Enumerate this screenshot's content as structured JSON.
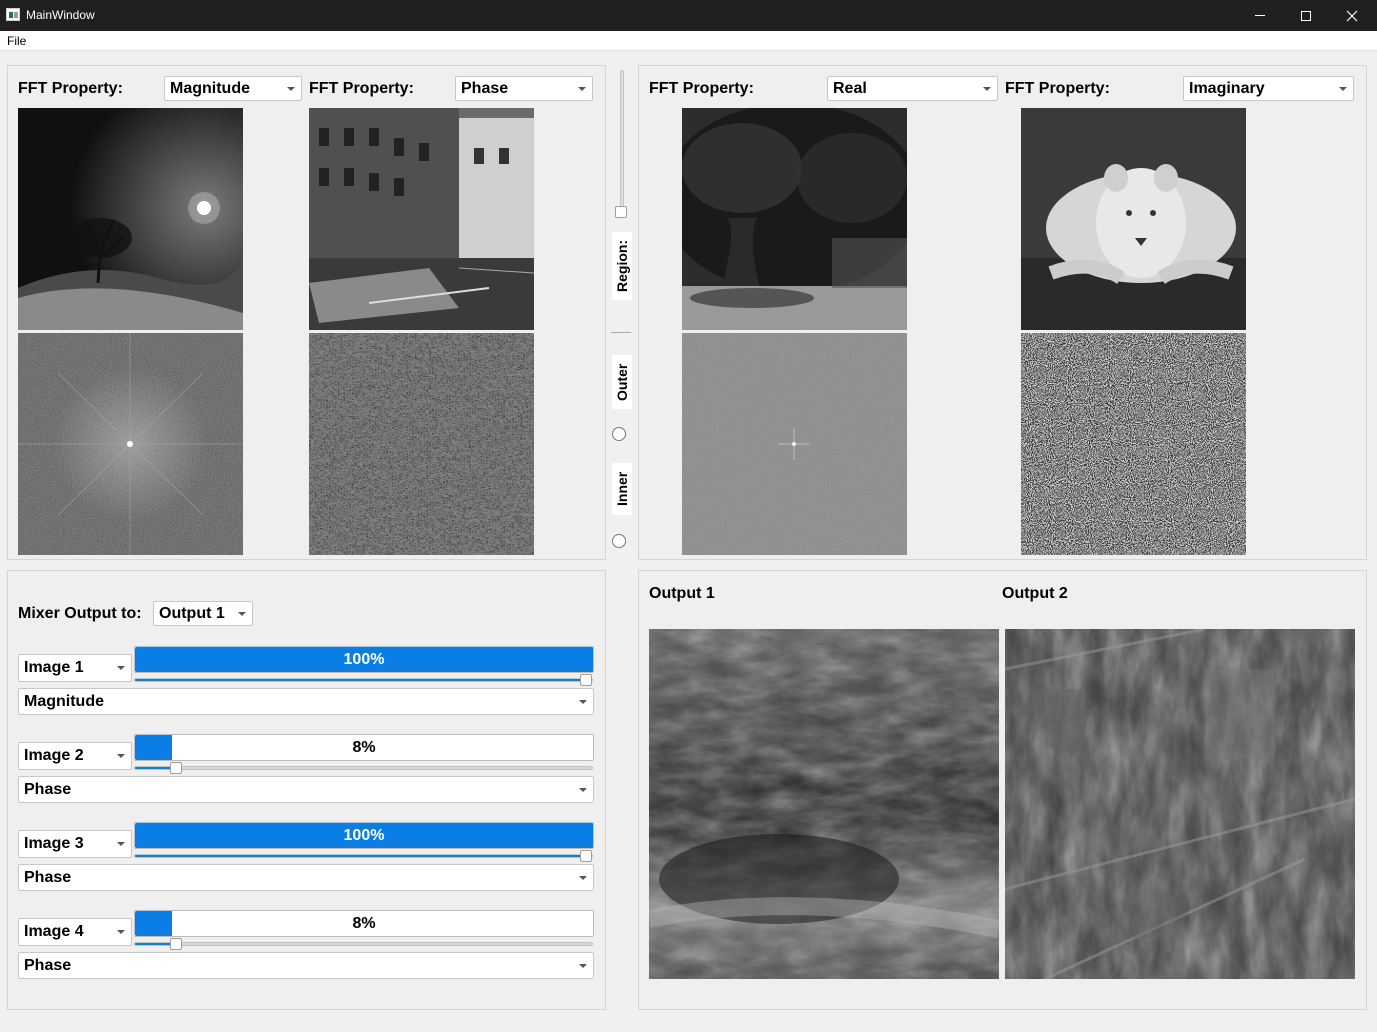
{
  "window": {
    "title": "MainWindow"
  },
  "menu": {
    "file": "File"
  },
  "inputs": [
    {
      "label": "FFT Property:",
      "component": "Magnitude"
    },
    {
      "label": "FFT Property:",
      "component": "Phase"
    },
    {
      "label": "FFT Property:",
      "component": "Real"
    },
    {
      "label": "FFT Property:",
      "component": "Imaginary"
    }
  ],
  "region": {
    "label": "Region:",
    "outer_label": "Outer",
    "inner_label": "Inner",
    "outer_selected": false,
    "inner_selected": false
  },
  "mixer": {
    "output_label": "Mixer Output to:",
    "output_value": "Output 1",
    "rows": [
      {
        "image": "Image 1",
        "weight": 100,
        "weight_text": "100%",
        "component": "Magnitude"
      },
      {
        "image": "Image 2",
        "weight": 8,
        "weight_text": "8%",
        "component": "Phase"
      },
      {
        "image": "Image 3",
        "weight": 100,
        "weight_text": "100%",
        "component": "Phase"
      },
      {
        "image": "Image 4",
        "weight": 8,
        "weight_text": "8%",
        "component": "Phase"
      }
    ]
  },
  "outputs": [
    {
      "label": "Output 1"
    },
    {
      "label": "Output 2"
    }
  ],
  "colors": {
    "accent": "#0a7ee6",
    "titlebar": "#202020",
    "panel": "#efefef"
  }
}
